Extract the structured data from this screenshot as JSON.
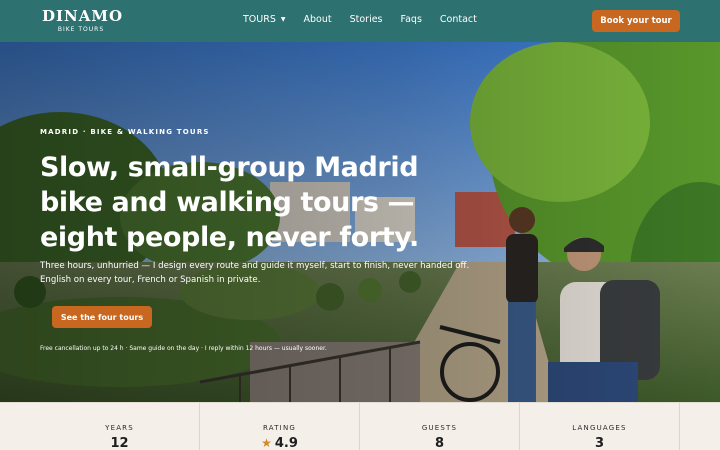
{
  "header": {
    "logo_word": "DINAMO",
    "logo_sub": "BIKE TOURS",
    "nav": [
      {
        "label": "TOURS",
        "has_dropdown": true
      },
      {
        "label": "About"
      },
      {
        "label": "Stories"
      },
      {
        "label": "Faqs"
      },
      {
        "label": "Contact"
      }
    ],
    "book_label": "Book your tour"
  },
  "hero": {
    "eyebrow": "MADRID · BIKE & WALKING TOURS",
    "headline": "Slow, small-group Madrid bike and walking tours — eight people, never forty.",
    "lede": "Three hours, unhurried — I design every route and guide it myself, start to finish, never handed off. English on every tour, French or Spanish in private.",
    "cta_label": "See the four tours",
    "reassurance": "Free cancellation up to 24 h · Same guide on the day · I reply within 12 hours — usually sooner."
  },
  "stats": [
    {
      "label": "YEARS",
      "value": "12"
    },
    {
      "label": "RATING",
      "value": "4.9",
      "icon": "star-icon"
    },
    {
      "label": "GUESTS",
      "value": "8"
    },
    {
      "label": "LANGUAGES",
      "value": "3"
    }
  ],
  "colors": {
    "header_bg": "#2d7170",
    "accent": "#c8671f",
    "strip_bg": "#f4efe9"
  }
}
